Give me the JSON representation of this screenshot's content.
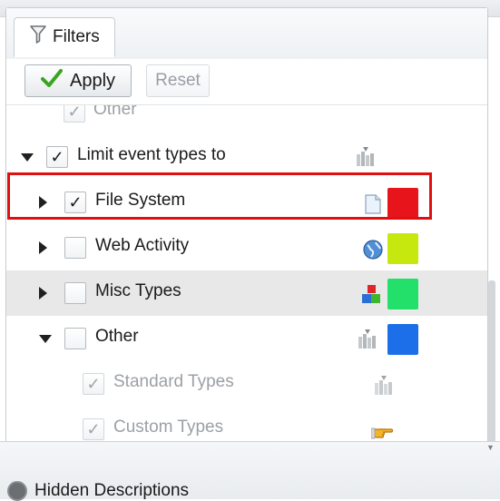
{
  "tab": {
    "label": "Filters",
    "icon": "filter-funnel-icon"
  },
  "toolbar": {
    "apply_label": "Apply",
    "reset_label": "Reset"
  },
  "rows": [
    {
      "label": "Other",
      "checked": true,
      "disabled": true
    },
    {
      "label": "Limit event types to",
      "checked": true,
      "expanded": true,
      "icon": "event-types-icon"
    },
    {
      "label": "File System",
      "checked": true,
      "expanded": false,
      "icon": "document-icon",
      "color": "#e8141c"
    },
    {
      "label": "Web Activity",
      "checked": false,
      "expanded": false,
      "icon": "globe-icon",
      "color": "#c6e80e"
    },
    {
      "label": "Misc Types",
      "checked": false,
      "expanded": false,
      "icon": "blocks-icon",
      "color": "#22e06a"
    },
    {
      "label": "Other",
      "checked": false,
      "expanded": true,
      "icon": "event-types-icon",
      "color": "#1c6fe8"
    },
    {
      "label": "Standard Types",
      "checked": true,
      "disabled": true,
      "icon": "event-types-icon"
    },
    {
      "label": "Custom Types",
      "checked": true,
      "disabled": true,
      "icon": "pointing-hand-icon"
    }
  ],
  "bottom": {
    "label": "Hidden Descriptions"
  },
  "colors": {
    "highlight_border": "#e01010",
    "alt_row": "#e8e8e8",
    "apply_check": "#3aa51f"
  }
}
